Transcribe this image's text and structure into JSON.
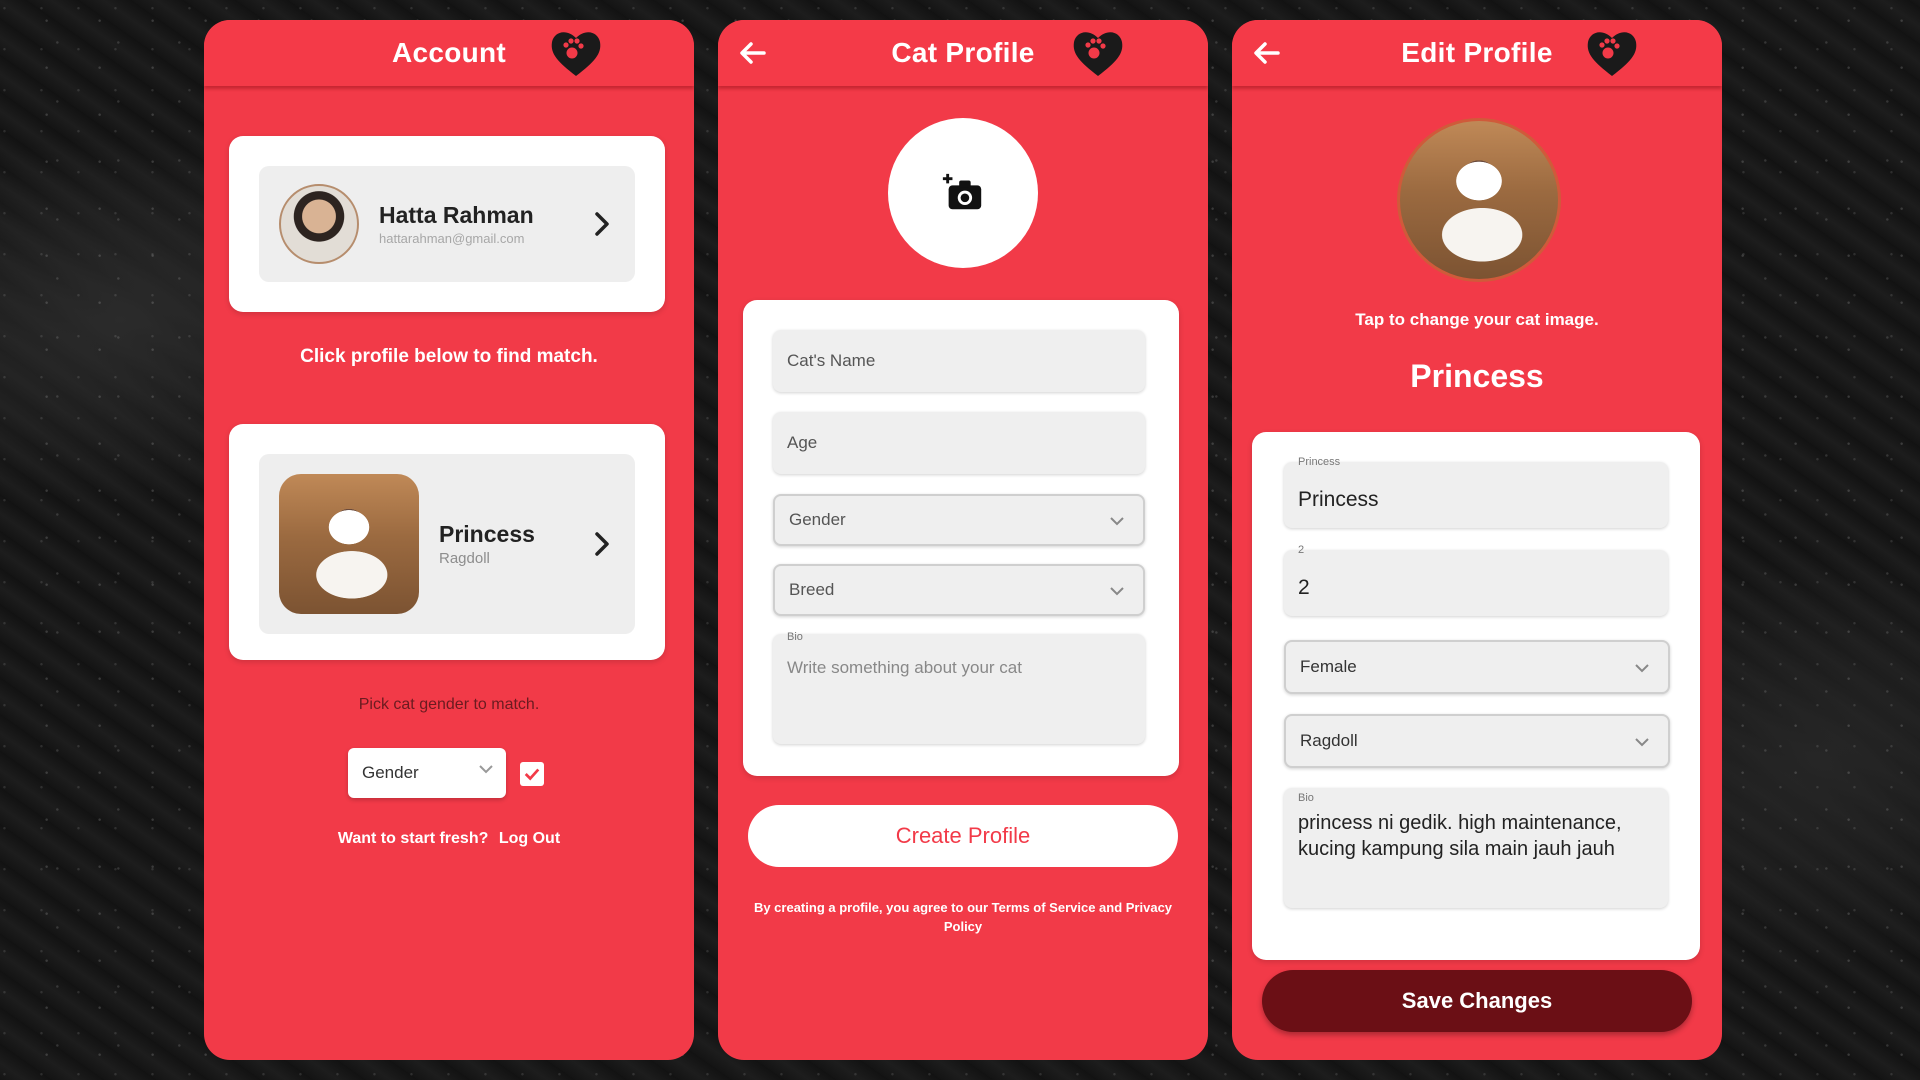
{
  "colors": {
    "primary": "#f23a48",
    "dark_button": "#6b0f15",
    "card": "#ffffff",
    "field": "#efefef"
  },
  "account": {
    "title": "Account",
    "user": {
      "name": "Hatta Rahman",
      "email": "hattarahman@gmail.com"
    },
    "find_caption": "Click profile below to find match.",
    "cat": {
      "name": "Princess",
      "breed": "Ragdoll"
    },
    "gender_caption": "Pick cat gender to match.",
    "gender_select": "Gender",
    "fresh_prompt": "Want to start fresh?",
    "logout_label": "Log Out"
  },
  "cat_profile": {
    "title": "Cat Profile",
    "name_placeholder": "Cat's Name",
    "age_placeholder": "Age",
    "gender_placeholder": "Gender",
    "breed_placeholder": "Breed",
    "bio_label": "Bio",
    "bio_placeholder": "Write something about your cat",
    "create_label": "Create Profile",
    "terms_text": "By creating a profile, you agree to our Terms of Service and Privacy Policy"
  },
  "edit_profile": {
    "title": "Edit Profile",
    "tap_caption": "Tap to change your cat image.",
    "cat_name_heading": "Princess",
    "name_label": "Princess",
    "name_value": "Princess",
    "age_label": "2",
    "age_value": "2",
    "gender_value": "Female",
    "breed_value": "Ragdoll",
    "bio_label": "Bio",
    "bio_value": "princess ni gedik. high maintenance, kucing kampung sila main jauh jauh",
    "save_label": "Save Changes"
  }
}
